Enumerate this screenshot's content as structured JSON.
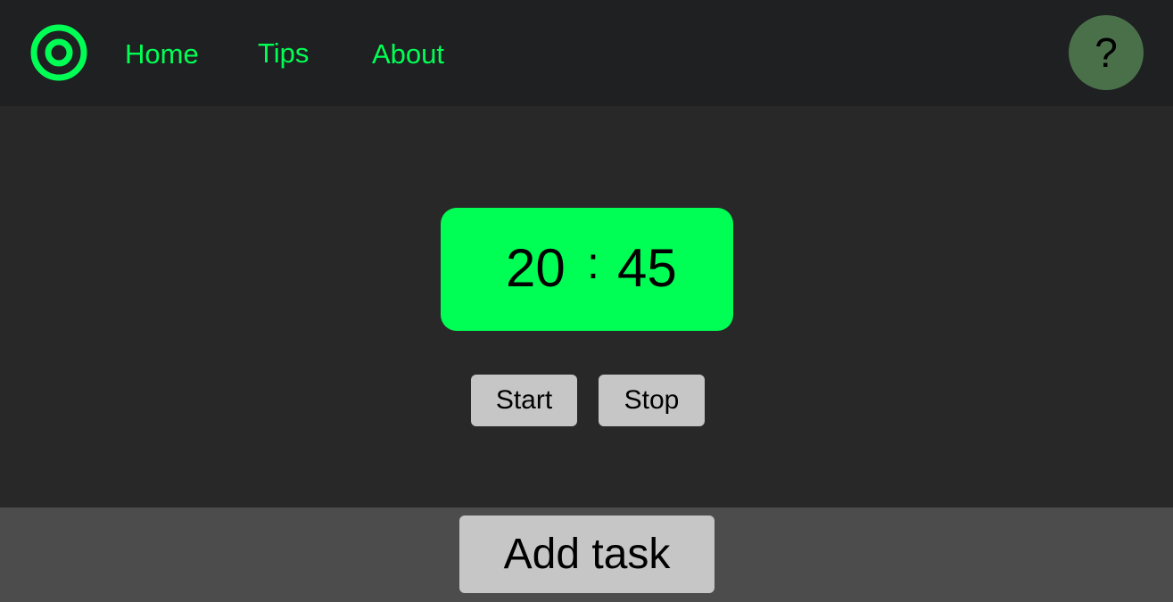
{
  "colors": {
    "accent": "#00ff55",
    "nav_background": "#1e2021",
    "main_background": "#282828",
    "footer_background": "#4c4c4c",
    "button_background": "#c6c6c6",
    "help_background": "#4a704a"
  },
  "nav": {
    "logo_icon": "target-icon",
    "links": [
      {
        "label": "Home"
      },
      {
        "label": "Tips"
      },
      {
        "label": "About"
      }
    ],
    "help_label": "?"
  },
  "timer": {
    "minutes": "20",
    "separator": ":",
    "seconds": "45"
  },
  "controls": {
    "start_label": "Start",
    "stop_label": "Stop"
  },
  "footer": {
    "add_task_label": "Add task"
  }
}
